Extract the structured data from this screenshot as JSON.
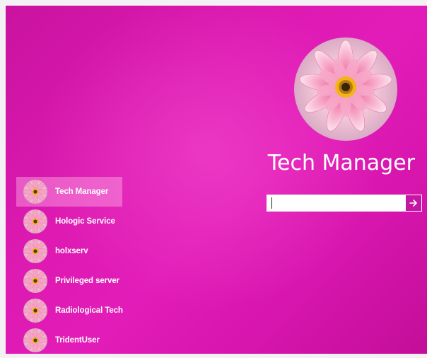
{
  "selected_user": {
    "name": "Tech Manager",
    "avatar_icon": "flower-avatar-icon"
  },
  "password": {
    "value": "",
    "placeholder": "",
    "submit_icon": "arrow-right-icon"
  },
  "users": [
    {
      "label": "Tech Manager",
      "selected": true
    },
    {
      "label": "Hologic Service",
      "selected": false
    },
    {
      "label": "holxserv",
      "selected": false
    },
    {
      "label": "Privileged server",
      "selected": false
    },
    {
      "label": "Radiological Tech",
      "selected": false
    },
    {
      "label": "TridentUser",
      "selected": false
    }
  ],
  "colors": {
    "background": "#dd1ab2",
    "accent": "#c616a4",
    "text": "#ffffff"
  }
}
